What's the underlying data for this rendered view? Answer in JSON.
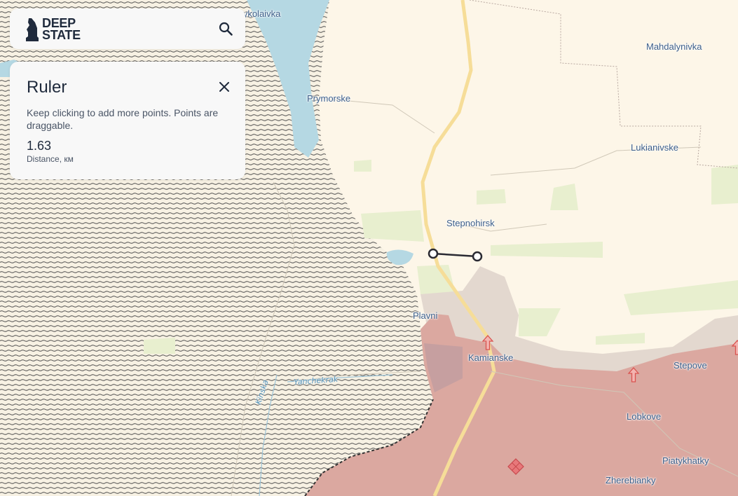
{
  "app": {
    "logo_line1": "DEEP",
    "logo_line2": "STATE"
  },
  "ruler": {
    "title": "Ruler",
    "hint": "Keep clicking to add more points. Points are draggable.",
    "distance_value": "1.63",
    "distance_label": "Distance, км"
  },
  "map": {
    "places": [
      {
        "id": "mykolaivka",
        "label": "Mykolaivka"
      },
      {
        "id": "mahdalynivka",
        "label": "Mahdalynivka"
      },
      {
        "id": "prymorske",
        "label": "Prymorske"
      },
      {
        "id": "lukianivske",
        "label": "Lukianivske"
      },
      {
        "id": "stepnohirsk",
        "label": "Stepnohirsk"
      },
      {
        "id": "plavni",
        "label": "Plavni"
      },
      {
        "id": "kamianske",
        "label": "Kamianske"
      },
      {
        "id": "stepove",
        "label": "Stepove"
      },
      {
        "id": "lobkove",
        "label": "Lobkove"
      },
      {
        "id": "piatykhatky",
        "label": "Piatykhatky"
      },
      {
        "id": "zherebianky",
        "label": "Zherebianky"
      }
    ],
    "rivers": [
      {
        "id": "yanchekrak",
        "label": "Yanchekrak"
      },
      {
        "id": "kinska",
        "label": "Kinska"
      }
    ],
    "colors": {
      "land": "#fdf6e8",
      "water": "#b5d8e3",
      "occupied": "#dba8a0",
      "grey_zone": "#e3d8cf",
      "green": "#e8efcf",
      "road": "#f6dd98",
      "marker": "#d9534f"
    }
  }
}
